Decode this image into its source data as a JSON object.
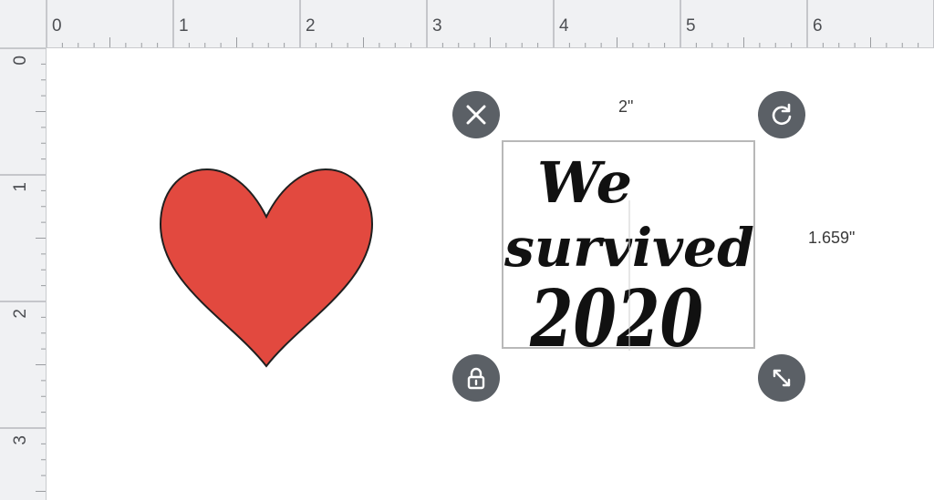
{
  "ruler": {
    "top_labels": [
      "0",
      "1",
      "2",
      "3",
      "4",
      "5",
      "6"
    ],
    "left_labels": [
      "0",
      "1",
      "2",
      "3"
    ]
  },
  "canvas": {
    "heart": {
      "fill_color": "#e2493f",
      "outline_color": "#1f1f1f"
    },
    "selected_design": {
      "text_lines": [
        "We",
        "survived",
        "2020"
      ],
      "width_label": "2\"",
      "height_label": "1.659\""
    }
  },
  "handles": {
    "delete": "close-icon",
    "rotate": "rotate-icon",
    "lock": "lock-icon",
    "resize": "resize-icon"
  },
  "colors": {
    "ruler_bg": "#f0f1f3",
    "handle_bg": "#5b6066",
    "selection_border": "#b8b8b8"
  }
}
